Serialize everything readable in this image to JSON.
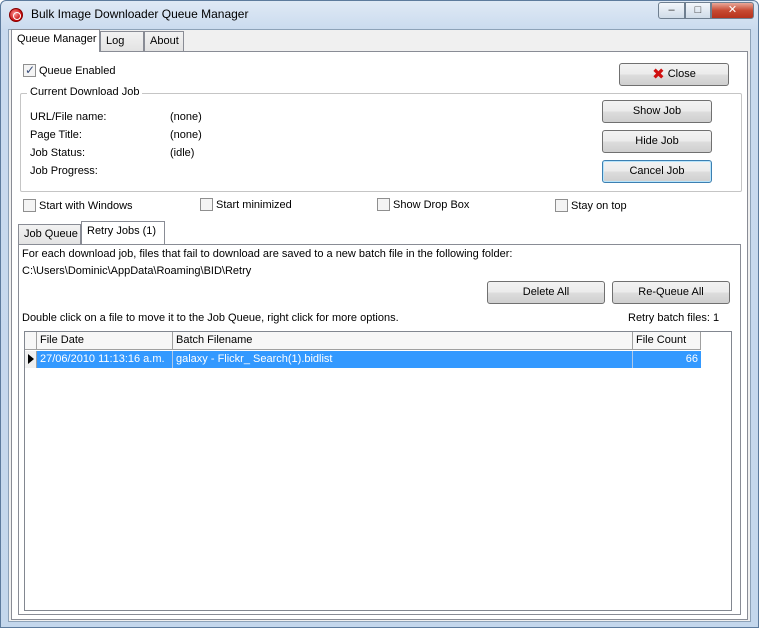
{
  "window": {
    "title": "Bulk Image Downloader Queue Manager",
    "min_glyph": "–",
    "max_glyph": "□",
    "close_glyph": "✕"
  },
  "main_tabs": [
    {
      "label": "Queue Manager",
      "active": true
    },
    {
      "label": "Log",
      "active": false
    },
    {
      "label": "About",
      "active": false
    }
  ],
  "queue_enabled": {
    "label": "Queue Enabled",
    "checked": true
  },
  "close_button": {
    "label": "Close",
    "icon": "red-x-icon"
  },
  "current_job": {
    "legend": "Current Download Job",
    "fields": [
      {
        "label": "URL/File name:",
        "value": "(none)"
      },
      {
        "label": "Page Title:",
        "value": "(none)"
      },
      {
        "label": "Job Status:",
        "value": "(idle)"
      },
      {
        "label": "Job Progress:",
        "value": ""
      }
    ],
    "buttons": {
      "show": "Show Job",
      "hide": "Hide Job",
      "cancel": "Cancel Job"
    }
  },
  "options": [
    {
      "label": "Start with Windows",
      "checked": false
    },
    {
      "label": "Start minimized",
      "checked": false
    },
    {
      "label": "Show Drop Box",
      "checked": false
    },
    {
      "label": "Stay on top",
      "checked": false
    }
  ],
  "sub_tabs": [
    {
      "label": "Job Queue",
      "active": false
    },
    {
      "label": "Retry Jobs (1)",
      "active": true
    }
  ],
  "retry": {
    "info_line": "For each download job, files that fail to download are saved to a new batch file in the following folder:",
    "folder": "C:\\Users\\Dominic\\AppData\\Roaming\\BID\\Retry",
    "delete_all": "Delete All",
    "requeue_all": "Re-Queue All",
    "hint": "Double click on a file to move it to the Job Queue, right click for more options.",
    "count_text": "Retry batch files: 1",
    "columns": [
      "File Date",
      "Batch Filename",
      "File Count"
    ],
    "rows": [
      {
        "date": "27/06/2010 11:13:16 a.m.",
        "filename": "galaxy - Flickr_ Search(1).bidlist",
        "count": "66"
      }
    ]
  },
  "colors": {
    "selection": "#3399ff",
    "accent_close": "#c74a32"
  }
}
